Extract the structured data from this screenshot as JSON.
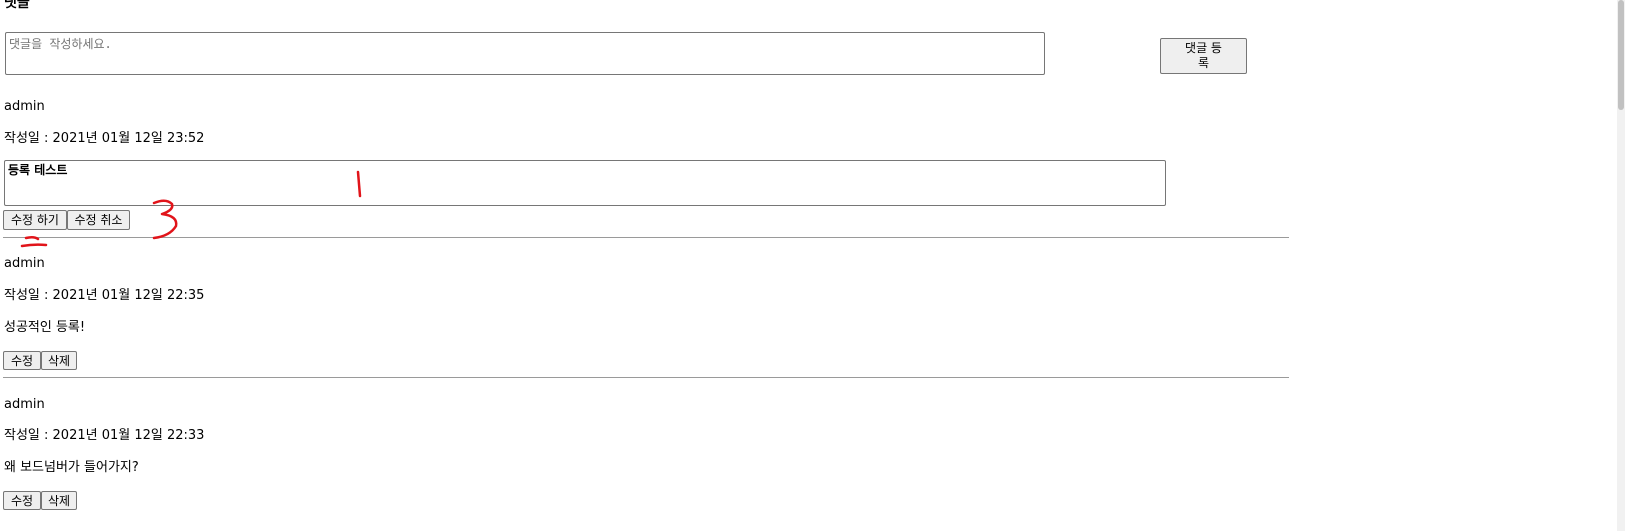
{
  "section": {
    "title": "댓글"
  },
  "comment_form": {
    "placeholder": "댓글을 작성하세요.",
    "submit_label": "댓글 등록"
  },
  "comments": [
    {
      "author": "admin",
      "date_label": "작성일 : 2021년 01월 12일 23:52",
      "edit_value": "등록 테스트",
      "buttons": [
        "수정 하기",
        "수정 취소"
      ]
    },
    {
      "author": "admin",
      "date_label": "작성일 : 2021년 01월 12일 22:35",
      "content": "성공적인 등록!",
      "buttons": [
        "수정",
        "삭제"
      ]
    },
    {
      "author": "admin",
      "date_label": "작성일 : 2021년 01월 12일 22:33",
      "content": "왜 보드넘버가 들어가지?",
      "buttons": [
        "수정",
        "삭제"
      ]
    }
  ],
  "annotations": {
    "color": "#e1141a",
    "marks": [
      "1",
      "2",
      "3"
    ]
  }
}
